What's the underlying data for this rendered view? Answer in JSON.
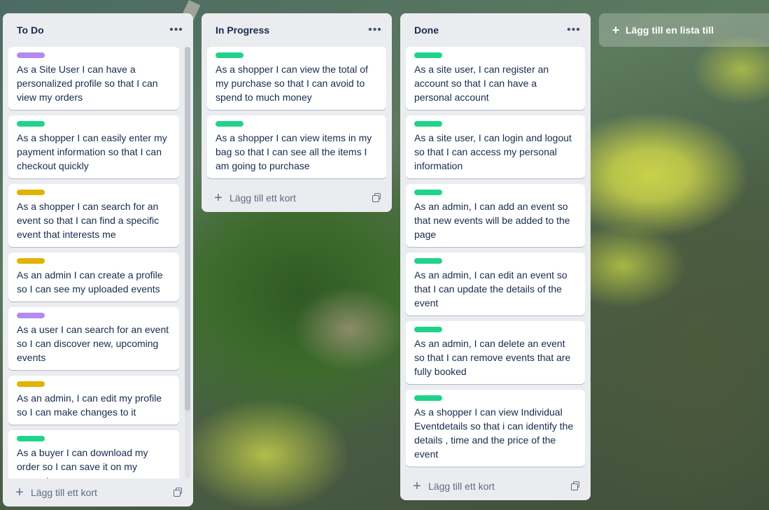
{
  "colors": {
    "green": "#1fd48a",
    "purple": "#b38af0",
    "yellow": "#e2b203"
  },
  "lists": [
    {
      "title": "To Do",
      "add_card": "Lägg till ett kort",
      "cards": [
        {
          "label": "purple",
          "text": "As a Site User I can have a personalized profile so that I can view my orders"
        },
        {
          "label": "green",
          "text": "As a shopper I can easily enter my payment information so that I can checkout quickly"
        },
        {
          "label": "yellow",
          "text": "As a shopper I can search for an event so that I can find a specific event that interests me"
        },
        {
          "label": "yellow",
          "text": "As an admin I can create a profile so I can see my uploaded events"
        },
        {
          "label": "purple",
          "text": "As a user I can search for an event so I can discover new, upcoming events"
        },
        {
          "label": "yellow",
          "text": "As an admin, I can edit my profile so I can make changes to it"
        },
        {
          "label": "green",
          "text": "As a buyer I can download my order so I can save it on my computer"
        }
      ]
    },
    {
      "title": "In Progress",
      "add_card": "Lägg till ett kort",
      "cards": [
        {
          "label": "green",
          "text": "As a shopper I can view the total of my purchase so that I can avoid to spend to much money"
        },
        {
          "label": "green",
          "text": "As a shopper I can view items in my bag so that I can see all the items I am going to purchase"
        }
      ]
    },
    {
      "title": "Done",
      "add_card": "Lägg till ett kort",
      "cards": [
        {
          "label": "green",
          "text": "As a site user, I can register an account so that I can have a personal account"
        },
        {
          "label": "green",
          "text": "As a site user, I can login and logout so that I can access my personal information"
        },
        {
          "label": "green",
          "text": "As an admin, I can add an event so that new events will be added to the page"
        },
        {
          "label": "green",
          "text": "As an admin, I can edit an event so that I can update the details of the event"
        },
        {
          "label": "green",
          "text": "As an admin, I can delete an event so that I can remove events that are fully booked"
        },
        {
          "label": "green",
          "text": "As a shopper I can view Individual Eventdetails so that i can identify the details , time and the price of the event"
        }
      ]
    }
  ],
  "add_list": "Lägg till en lista till",
  "icons": {
    "more": "more-dots-icon",
    "plus": "plus-icon",
    "template": "card-template-icon"
  }
}
